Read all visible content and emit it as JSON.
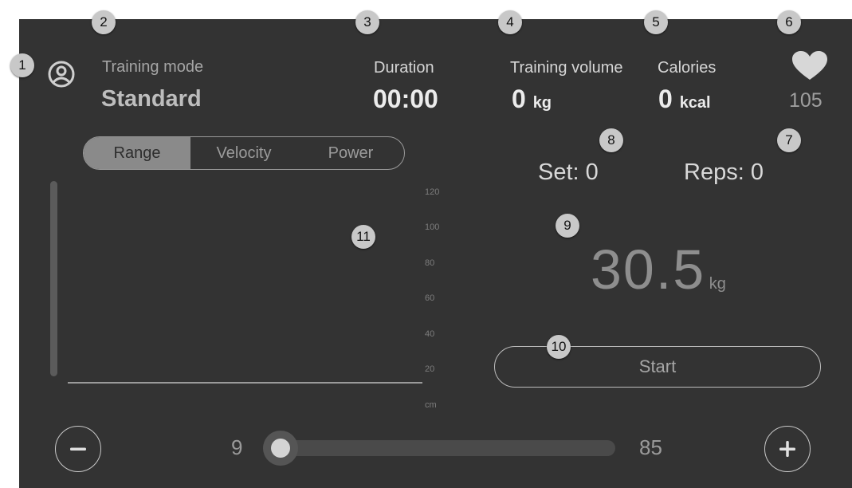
{
  "header": {
    "training_mode": {
      "label": "Training mode",
      "value": "Standard"
    },
    "duration": {
      "label": "Duration",
      "value": "00:00"
    },
    "training_volume": {
      "label": "Training volume",
      "value": "0",
      "unit": "kg"
    },
    "calories": {
      "label": "Calories",
      "value": "0",
      "unit": "kcal"
    },
    "heart_rate": {
      "value": "105"
    }
  },
  "tabs": [
    {
      "label": "Range",
      "active": true
    },
    {
      "label": "Velocity",
      "active": false
    },
    {
      "label": "Power",
      "active": false
    }
  ],
  "set": {
    "text": "Set: 0"
  },
  "reps": {
    "text": "Reps: 0"
  },
  "weight": {
    "value": "30.5",
    "unit": "kg"
  },
  "chart_data": {
    "type": "line",
    "y_ticks": [
      "120",
      "100",
      "80",
      "60",
      "40",
      "20",
      "cm"
    ],
    "series": []
  },
  "start_button": {
    "label": "Start"
  },
  "slider": {
    "min_label": "9",
    "max_label": "85",
    "value_fraction": 0.0
  },
  "callouts": [
    "1",
    "2",
    "3",
    "4",
    "5",
    "6",
    "7",
    "8",
    "9",
    "10",
    "11"
  ],
  "colors": {
    "panel": "#333333",
    "accent_grey": "#8a8a8a",
    "text_light": "#ececec"
  }
}
